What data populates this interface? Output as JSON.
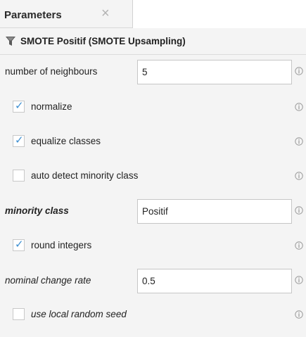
{
  "tab": {
    "title": "Parameters",
    "close_glyph": "×"
  },
  "operator": {
    "name": "SMOTE Positif (SMOTE Upsampling)",
    "icon": "filter-icon"
  },
  "params": {
    "number_of_neighbours": {
      "label": "number of neighbours",
      "value": "5"
    },
    "normalize": {
      "label": "normalize",
      "checked": true
    },
    "equalize_classes": {
      "label": "equalize classes",
      "checked": true
    },
    "auto_detect_minority_class": {
      "label": "auto detect minority class",
      "checked": false
    },
    "minority_class": {
      "label": "minority class",
      "value": "Positif"
    },
    "round_integers": {
      "label": "round integers",
      "checked": true
    },
    "nominal_change_rate": {
      "label": "nominal change rate",
      "value": "0.5"
    },
    "use_local_random_seed": {
      "label": "use local random seed",
      "checked": false
    }
  },
  "colors": {
    "panel_bg": "#f4f4f4",
    "check": "#3d8fd1",
    "info_icon": "#9a9a9a"
  },
  "check_glyph": "✓"
}
